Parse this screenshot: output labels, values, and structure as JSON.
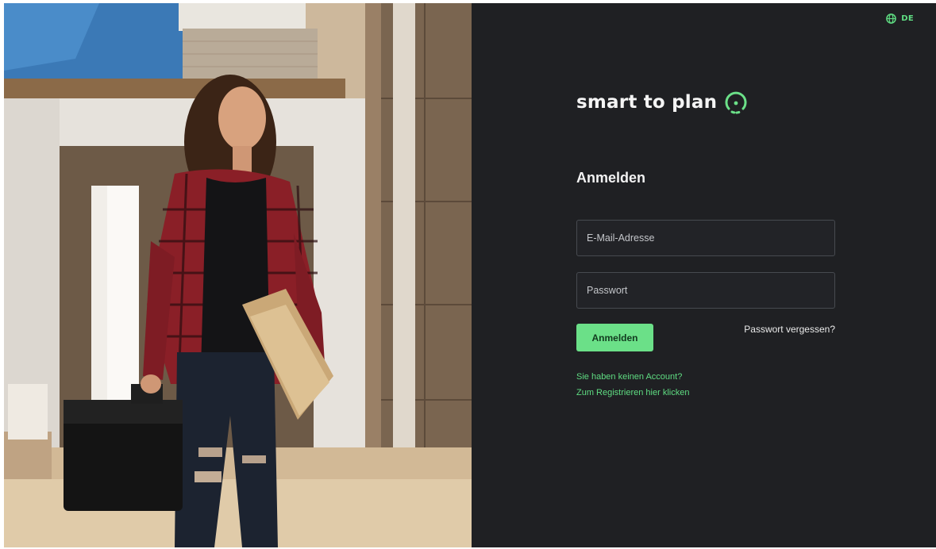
{
  "language": {
    "label": "DE",
    "icon": "globe-icon"
  },
  "brand": {
    "name": "smart to plan",
    "icon": "smile-circle-icon"
  },
  "login": {
    "heading": "Anmelden",
    "email_placeholder": "E-Mail-Adresse",
    "password_placeholder": "Passwort",
    "submit_label": "Anmelden",
    "forgot_label": "Passwort vergessen?",
    "no_account_text": "Sie haben keinen Account?",
    "register_link": "Zum Registrieren hier klicken"
  },
  "colors": {
    "accent": "#6be088",
    "accent_text": "#5fdc82",
    "panel_bg": "#1f2023"
  }
}
